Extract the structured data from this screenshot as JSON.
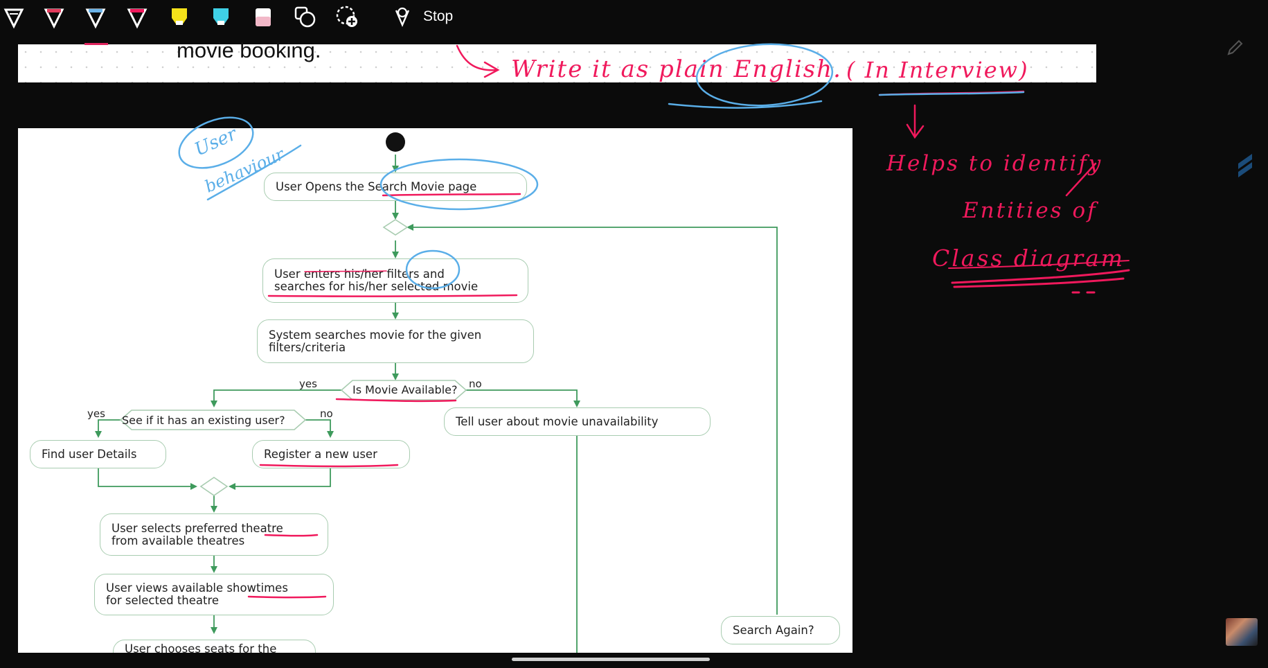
{
  "toolbar": {
    "tools": [
      {
        "name": "pen-white-icon",
        "color": "#ffffff"
      },
      {
        "name": "pen-red-icon",
        "color": "#e23b5c"
      },
      {
        "name": "pen-blue-icon",
        "color": "#6bb3e8"
      },
      {
        "name": "pen-pink-icon",
        "color": "#f0195c"
      },
      {
        "name": "highlighter-yellow-icon",
        "color": "#f4e11a"
      },
      {
        "name": "highlighter-cyan-icon",
        "color": "#3fd0e6"
      },
      {
        "name": "eraser-icon",
        "color": "#f2b8c8"
      },
      {
        "name": "shapes-icon",
        "color": "#ffffff"
      },
      {
        "name": "lasso-add-icon",
        "color": "#ffffff"
      }
    ],
    "stop_label": "Stop"
  },
  "strip": {
    "text": "movie booking."
  },
  "diagram": {
    "nodes": {
      "open_search_prefix": "User Opens the ",
      "open_search_highlight": "Search Movie page",
      "filters_line1": "User enters his/her filters and",
      "filters_line2": "searches for his/her selected movie",
      "system_line1": "System searches movie for the given",
      "system_line2": "filters/criteria",
      "movie_available": "Is Movie Available?",
      "existing_user": "See if it has an existing user?",
      "unavailable": "Tell user about movie unavailability",
      "find_user": "Find user Details",
      "register": "Register a new user",
      "theatre_line1": "User selects preferred theatre",
      "theatre_line2": "from available theatres",
      "showtimes_line1": "User views available showtimes",
      "showtimes_line2": "for selected theatre",
      "seats_partial": "User chooses seats for the",
      "search_again": "Search Again?"
    },
    "labels": {
      "yes_available": "yes",
      "no_available": "no",
      "yes_existing": "yes",
      "no_existing": "no"
    }
  },
  "annotations": {
    "write_plain": "Write it as plain English.",
    "in_interview": "( In Interview)",
    "helps_line1": "Helps to identify",
    "helps_line2": "Entities of",
    "helps_line3": "Class diagram",
    "user_behaviour_line1": "User",
    "user_behaviour_line2": "behaviour"
  },
  "colors": {
    "background": "#0b0b0b",
    "flow_line": "#3e9a5c",
    "node_border": "#a8ccb0",
    "annotation_red": "#f0195c",
    "annotation_blue": "#5aaee8"
  }
}
